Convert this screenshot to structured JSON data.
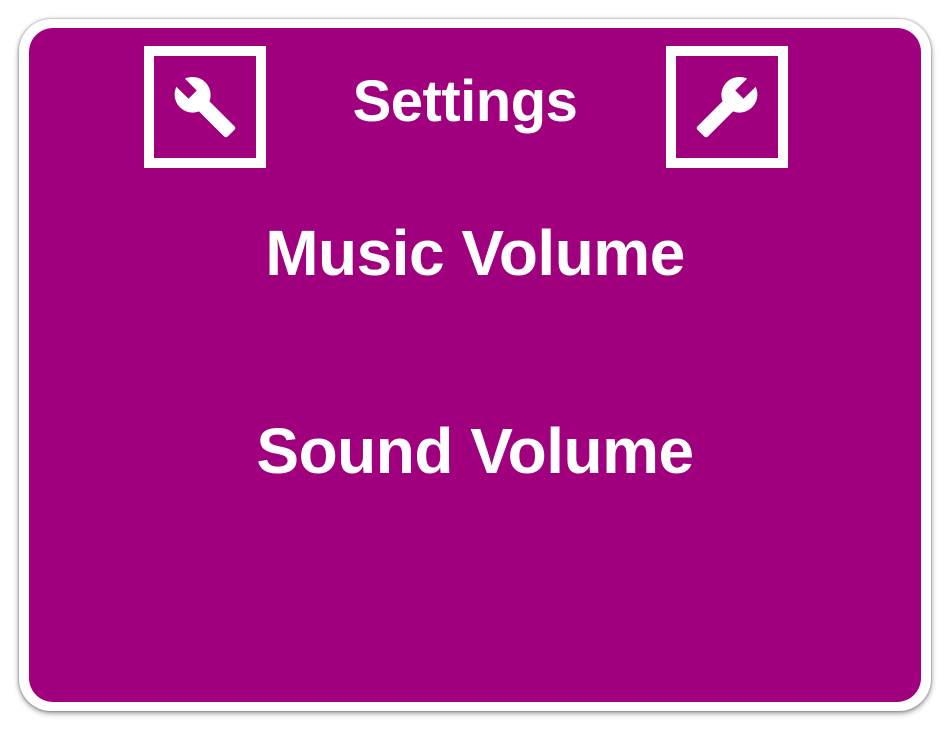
{
  "settings_panel": {
    "title": "Settings",
    "left_icon": "wrench-icon",
    "right_icon": "wrench-icon",
    "items": [
      {
        "label": "Music Volume"
      },
      {
        "label": "Sound Volume"
      }
    ]
  },
  "colors": {
    "panel_background": "#a0007e",
    "border": "#ffffff",
    "text": "#ffffff"
  }
}
